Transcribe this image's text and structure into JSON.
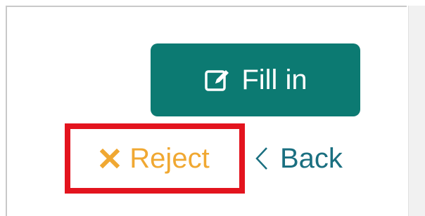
{
  "actions": {
    "fill_in": {
      "label": "Fill in",
      "icon": "edit-icon",
      "color": "#0c7a72"
    },
    "reject": {
      "label": "Reject",
      "icon": "close-icon",
      "color": "#f0a832",
      "highlight_color": "#e3141e"
    },
    "back": {
      "label": "Back",
      "icon": "chevron-left-icon",
      "color": "#1a6f80"
    }
  }
}
